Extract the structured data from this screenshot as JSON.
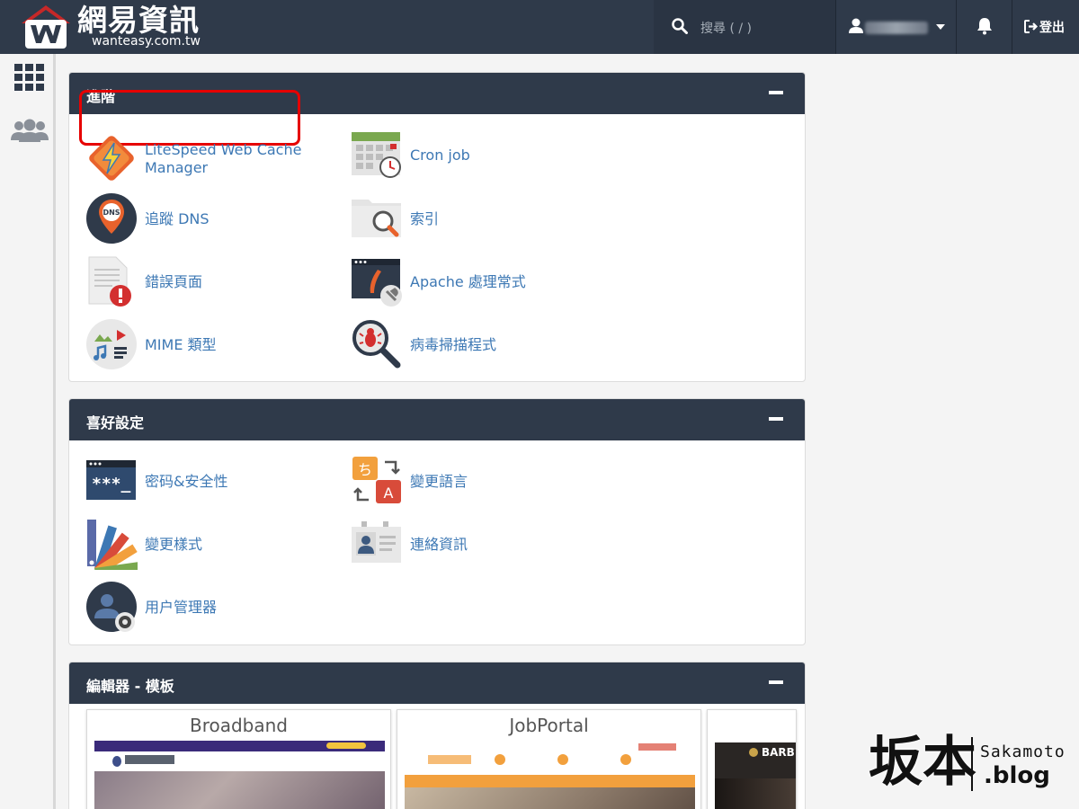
{
  "header": {
    "logo_title": "網易資訊",
    "logo_subtitle": "wanteasy.com.tw",
    "search_placeholder": "搜尋 ( / )",
    "logout_label": "登出"
  },
  "sidebar": {
    "items": [
      {
        "icon": "grid-icon"
      },
      {
        "icon": "users-icon"
      }
    ]
  },
  "sections": [
    {
      "title": "進階",
      "items": [
        {
          "label_line1": "LiteSpeed Web Cache",
          "label_line2": "Manager",
          "icon": "litespeed-icon",
          "highlighted": true
        },
        {
          "label": "Cron job",
          "icon": "calendar-clock-icon"
        },
        {
          "label": "追蹤 DNS",
          "icon": "dns-icon"
        },
        {
          "label": "索引",
          "icon": "folder-search-icon"
        },
        {
          "label": "錯誤頁面",
          "icon": "error-page-icon"
        },
        {
          "label": "Apache 處理常式",
          "icon": "apache-handler-icon"
        },
        {
          "label": "MIME 類型",
          "icon": "mime-icon"
        },
        {
          "label": "病毒掃描程式",
          "icon": "virus-scan-icon"
        }
      ]
    },
    {
      "title": "喜好設定",
      "items": [
        {
          "label": "密码&安全性",
          "icon": "password-icon"
        },
        {
          "label": "變更語言",
          "icon": "language-icon"
        },
        {
          "label": "變更樣式",
          "icon": "style-icon"
        },
        {
          "label": "連絡資訊",
          "icon": "contact-icon"
        },
        {
          "label": "用户管理器",
          "icon": "user-manager-icon"
        }
      ]
    },
    {
      "title": "編輯器 - 模板",
      "templates": [
        {
          "name": "Broadband"
        },
        {
          "name": "JobPortal"
        },
        {
          "name": "BARB"
        }
      ]
    }
  ],
  "watermark": {
    "brand_cn": "坂本",
    "brand_en": "Sakamoto",
    "brand_tld": ".blog"
  },
  "colors": {
    "header_bg": "#2f3a4a",
    "link": "#3d78b4",
    "highlight": "#e60000"
  }
}
